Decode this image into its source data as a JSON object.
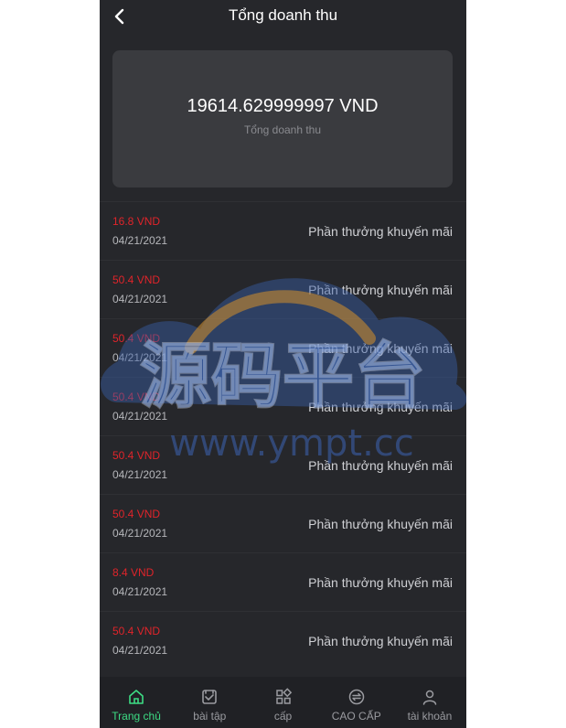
{
  "header": {
    "title": "Tổng doanh thu",
    "back_icon": "chevron-left-icon"
  },
  "summary": {
    "amount": "19614.629999997 VND",
    "label": "Tổng doanh thu"
  },
  "transactions": [
    {
      "amount": "16.8 VND",
      "date": "04/21/2021",
      "description": "Phần thưởng khuyến mãi"
    },
    {
      "amount": "50.4 VND",
      "date": "04/21/2021",
      "description": "Phần thưởng khuyến mãi"
    },
    {
      "amount": "50.4 VND",
      "date": "04/21/2021",
      "description": "Phần thưởng khuyến mãi"
    },
    {
      "amount": "50.4 VND",
      "date": "04/21/2021",
      "description": "Phần thưởng khuyến mãi"
    },
    {
      "amount": "50.4 VND",
      "date": "04/21/2021",
      "description": "Phần thưởng khuyến mãi"
    },
    {
      "amount": "50.4 VND",
      "date": "04/21/2021",
      "description": "Phần thưởng khuyến mãi"
    },
    {
      "amount": "8.4 VND",
      "date": "04/21/2021",
      "description": "Phần thưởng khuyến mãi"
    },
    {
      "amount": "50.4 VND",
      "date": "04/21/2021",
      "description": "Phần thưởng khuyến mãi"
    }
  ],
  "watermark": {
    "text_cn": "源码平台",
    "text_url": "www.ympt.cc"
  },
  "nav": {
    "items": [
      {
        "label": "Trang chủ",
        "icon": "home-icon",
        "active": true
      },
      {
        "label": "bài tập",
        "icon": "task-icon",
        "active": false
      },
      {
        "label": "cấp",
        "icon": "grid-icon",
        "active": false
      },
      {
        "label": "CAO CẤP",
        "icon": "exchange-icon",
        "active": false
      },
      {
        "label": "tài khoản",
        "icon": "user-icon",
        "active": false
      }
    ]
  },
  "colors": {
    "background": "#26272b",
    "card": "#3a3b3f",
    "amount_red": "#e0242a",
    "active_green": "#3ddc84"
  }
}
